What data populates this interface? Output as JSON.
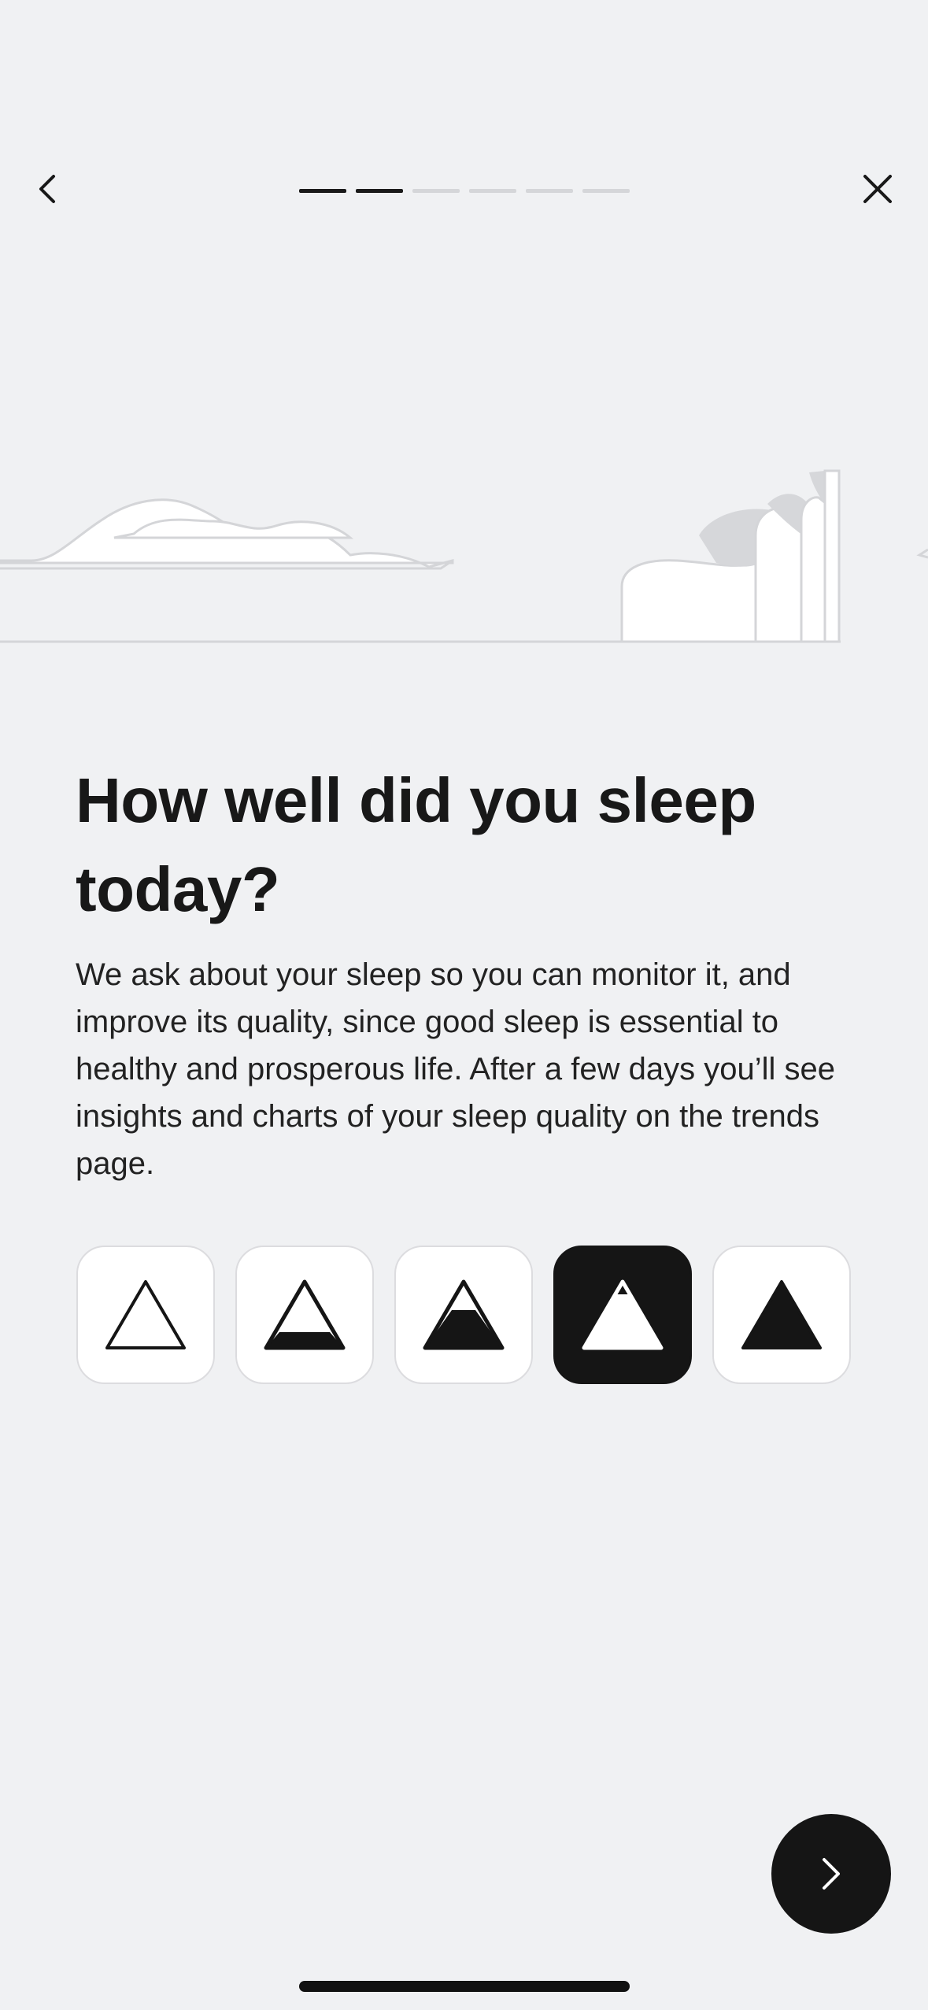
{
  "header": {
    "back_icon": "chevron-left-icon",
    "close_icon": "close-icon",
    "progress": {
      "total_steps": 6,
      "completed_steps": 2,
      "active_color": "#1a1a1a",
      "inactive_color": "#d5d6d9"
    }
  },
  "illustration": {
    "name": "sleep-landscape-illustration"
  },
  "content": {
    "title": "How well did you sleep today?",
    "description": "We ask about your sleep so you can monitor it, and improve its quality, since good sleep is essential to healthy and prosperous life. After a few days you’ll see insights and charts of your sleep quality on the trends page."
  },
  "rating": {
    "options": [
      {
        "icon": "triangle-empty-icon",
        "fill_level": 0
      },
      {
        "icon": "triangle-quarter-icon",
        "fill_level": 0.25
      },
      {
        "icon": "triangle-half-icon",
        "fill_level": 0.5
      },
      {
        "icon": "triangle-three-quarter-icon",
        "fill_level": 0.75
      },
      {
        "icon": "triangle-full-icon",
        "fill_level": 1
      }
    ],
    "selected_index": 3,
    "selected_color": "#151515"
  },
  "footer": {
    "next_icon": "chevron-right-icon"
  }
}
